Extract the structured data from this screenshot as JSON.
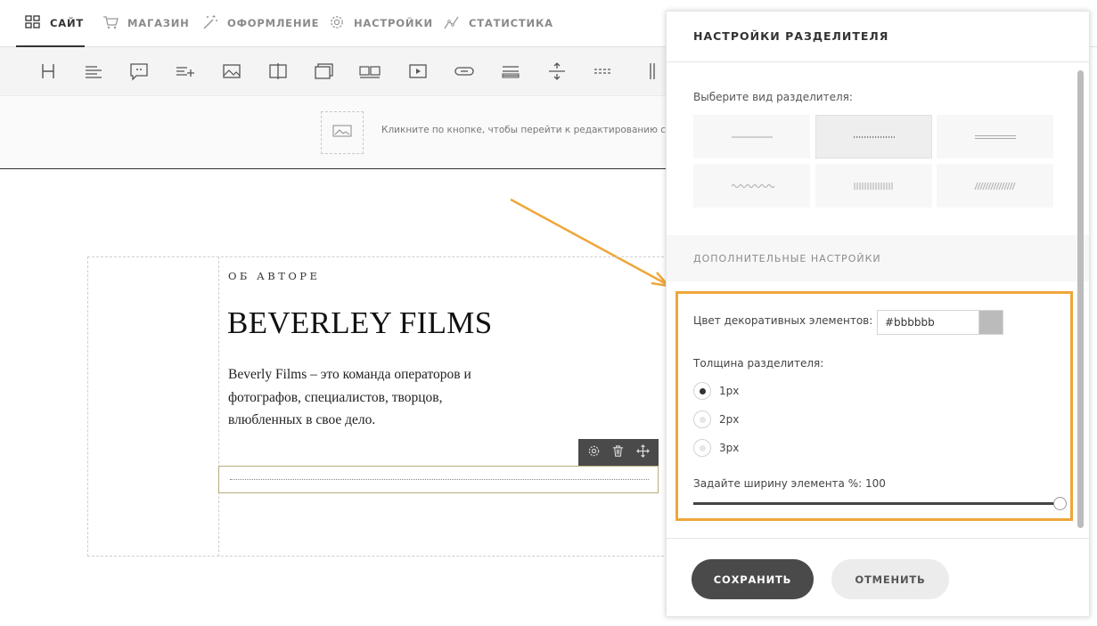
{
  "nav": {
    "items": [
      {
        "label": "САЙТ",
        "icon": "grid-icon"
      },
      {
        "label": "МАГАЗИН",
        "icon": "cart-icon"
      },
      {
        "label": "ОФОРМЛЕНИЕ",
        "icon": "magic-wand-icon"
      },
      {
        "label": "НАСТРОЙКИ",
        "icon": "gear-icon"
      },
      {
        "label": "СТАТИСТИКА",
        "icon": "chart-line-icon"
      }
    ]
  },
  "toolbar": {
    "icons": [
      "heading-icon",
      "text-icon",
      "quote-icon",
      "list-add-icon",
      "image-icon",
      "image-compare-icon",
      "gallery-icon",
      "images-icon",
      "video-icon",
      "link-button-icon",
      "lines-icon",
      "spacer-icon",
      "divider-icon",
      "columns-icon"
    ]
  },
  "slide": {
    "hint": "Кликните по кнопке, чтобы перейти к редактированию слайд"
  },
  "canvas": {
    "overline": "ОБ АВТОРЕ",
    "headline": "BEVERLEY FILMS",
    "body": "Beverly Films – это команда операторов и фотографов, специалистов, творцов, влюбленных в свое дело."
  },
  "panel": {
    "title": "НАСТРОЙКИ РАЗДЕЛИТЕЛЯ",
    "choose_label": "Выберите вид разделителя:",
    "divider_styles": [
      "solid",
      "dotted",
      "double",
      "wavy",
      "vertical-bars",
      "slashes"
    ],
    "selected_style": "dotted",
    "extra_title": "ДОПОЛНИТЕЛЬНЫЕ НАСТРОЙКИ",
    "color_label": "Цвет декоративных элементов:",
    "color_value": "#bbbbbb",
    "thickness_label": "Толщина разделителя:",
    "thickness_options": [
      "1px",
      "2px",
      "3px"
    ],
    "thickness_selected": "1px",
    "width_label": "Задайте ширину элемента %: 100",
    "width_percent": 100,
    "save_label": "СОХРАНИТЬ",
    "cancel_label": "ОТМЕНИТЬ"
  },
  "colors": {
    "accent_orange": "#eea73b",
    "dark": "#4a4a4a",
    "swatch": "#bbbbbb"
  }
}
